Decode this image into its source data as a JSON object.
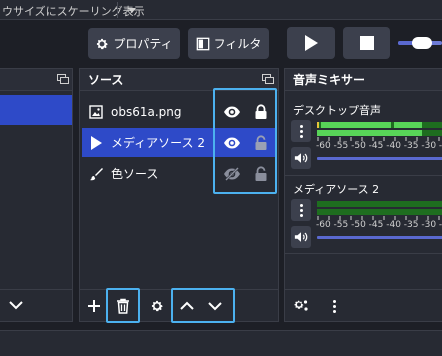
{
  "top_bar": {
    "scale_mode_label": "ウサイズにスケーリング表示"
  },
  "toolbar": {
    "properties_label": "プロパティ",
    "filters_label": "フィルタ"
  },
  "sources_panel": {
    "title": "ソース",
    "items": [
      {
        "label": "obs61a.png",
        "type_icon": "image-icon",
        "visible": true,
        "locked": true,
        "selected": false
      },
      {
        "label": "メディアソース 2",
        "type_icon": "play-icon",
        "visible": true,
        "locked": false,
        "selected": true
      },
      {
        "label": "色ソース",
        "type_icon": "brush-icon",
        "visible": false,
        "locked": false,
        "selected": false
      }
    ]
  },
  "mixer_panel": {
    "title": "音声ミキサー",
    "channels": [
      {
        "name": "デスクトップ音声",
        "scale": "-60 -55 -50 -45 -40 -35 -30 -"
      },
      {
        "name": "メディアソース 2",
        "scale": "-60 -55 -50 -45 -40 -35 -30 -"
      }
    ]
  },
  "colors": {
    "accent": "#2e4ac8",
    "highlight": "#4cb1ef",
    "meter_green": "#58d458",
    "meter_dark": "#1e6d1f",
    "background": "#1d1f26"
  }
}
